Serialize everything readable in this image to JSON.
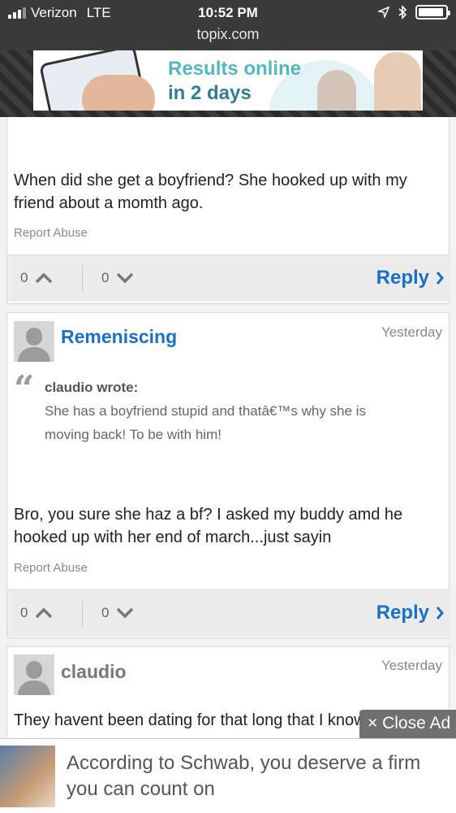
{
  "status_bar": {
    "carrier": "Verizon",
    "network": "LTE",
    "time": "10:52 PM",
    "url": "topix.com",
    "battery_level": 0.95
  },
  "top_ad": {
    "line1": "Results online",
    "line2": "in 2 days"
  },
  "comments": [
    {
      "body": "When did she get a boyfriend? She hooked up with my friend about a momth ago.",
      "report": "Report Abuse",
      "upvotes": "0",
      "downvotes": "0",
      "reply": "Reply"
    },
    {
      "author": "Remeniscing",
      "when": "Yesterday",
      "quote_author": "claudio wrote:",
      "quote_text": "She has a boyfriend stupid and thatâ€™s why she is moving back! To be with him!",
      "body": "Bro, you sure she haz a bf? I asked my buddy amd he hooked up with her end of march...just sayin",
      "report": "Report Abuse",
      "upvotes": "0",
      "downvotes": "0",
      "reply": "Reply"
    },
    {
      "author": "claudio",
      "when": "Yesterday",
      "body": "They havent been dating for that long that I know of but"
    }
  ],
  "bottom_ad": {
    "close_label": "× Close Ad",
    "copy": "According to Schwab, you deserve a firm you can count on"
  },
  "colors": {
    "link_blue": "#1a70c6",
    "status_bar": "#3a3a3a"
  }
}
